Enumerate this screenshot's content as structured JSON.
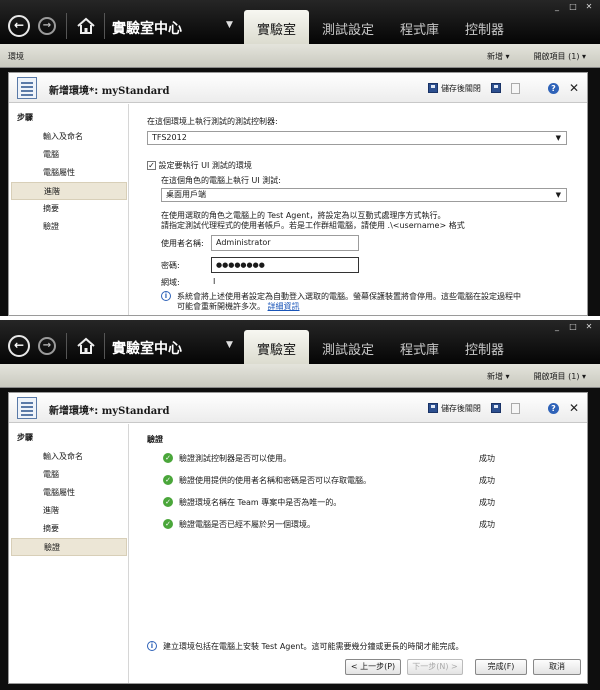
{
  "window_controls": [
    "_",
    "□",
    "✕"
  ],
  "nav": {
    "center_title": "實驗室中心"
  },
  "tabs": [
    "實驗室",
    "測試設定",
    "程式庫",
    "控制器"
  ],
  "subbar": {
    "left": "環境",
    "new_menu": "新增 ▾",
    "open_items": "開啟項目 (1) ▾"
  },
  "panel": {
    "title_prefix": "新增環境*: ",
    "title_doc": "myStandard",
    "save_close": "儲存後關閉",
    "close_glyph": "✕",
    "help_glyph": "?"
  },
  "steps": {
    "header": "步驟",
    "items": [
      "輸入及命名",
      "電腦",
      "電腦屬性",
      "進階",
      "摘要",
      "驗證"
    ]
  },
  "advanced": {
    "controller_label": "在這個環境上執行測試的測試控制器:",
    "controller_value": "TFS2012",
    "ui_checkbox_label": "設定要執行 UI 測試的環境",
    "role_label": "在這個角色的電腦上執行 UI 測試:",
    "role_value": "桌面用戶端",
    "desc_line1": "在使用選取的角色之電腦上的 Test Agent，將設定為以互動式處理序方式執行。",
    "desc_line2": "請指定測試代理程式的使用者帳戶。若是工作群組電腦，請使用 .\\<username> 格式",
    "username_label": "使用者名稱:",
    "username_value": "Administrator",
    "password_label": "密碼:",
    "password_value": "●●●●●●●●",
    "domain_label": "網域:",
    "domain_value": "I",
    "info_line1": "系統會將上述使用者設定為自動登入選取的電腦。螢幕保護裝置將會停用。這些電腦在設定過程中",
    "info_line2": "可能會重新開機許多次。",
    "info_link": "詳細資訊"
  },
  "verify": {
    "header": "驗證",
    "rows": [
      {
        "label": "驗證測試控制器是否可以使用。",
        "status": "成功"
      },
      {
        "label": "驗證使用提供的使用者名稱和密碼是否可以存取電腦。",
        "status": "成功"
      },
      {
        "label": "驗證環境名稱在 Team 專案中是否為唯一的。",
        "status": "成功"
      },
      {
        "label": "驗證電腦是否已經不屬於另一個環境。",
        "status": "成功"
      }
    ],
    "footer_info": "建立環境包括在電腦上安裝 Test Agent。這可能需要幾分鐘或更長的時間才能完成。",
    "buttons": {
      "prev": "< 上一步(P)",
      "next": "下一步(N) >",
      "finish": "完成(F)",
      "cancel": "取消"
    }
  },
  "colors": {
    "ok": "#4aa63a",
    "link": "#1a55b8",
    "selected_step": "#ece6d6"
  }
}
